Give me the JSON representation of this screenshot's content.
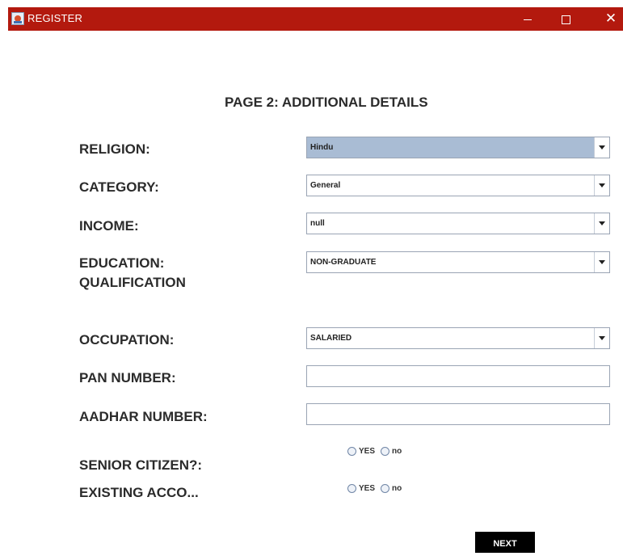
{
  "window": {
    "title": "REGISTER",
    "controls": {
      "minimize": "minimize-icon",
      "maximize": "maximize-icon",
      "close": "close-icon"
    }
  },
  "form": {
    "heading": "PAGE 2: ADDITIONAL DETAILS",
    "religion": {
      "label": "RELIGION:",
      "value": "Hindu"
    },
    "category": {
      "label": "CATEGORY:",
      "value": "General"
    },
    "income": {
      "label": "INCOME:",
      "value": "null"
    },
    "education": {
      "label_line1": "EDUCATION:",
      "label_line2": "QUALIFICATION",
      "value": "NON-GRADUATE"
    },
    "occupation": {
      "label": "OCCUPATION:",
      "value": "SALARIED"
    },
    "pan": {
      "label": "PAN NUMBER:",
      "value": ""
    },
    "aadhar": {
      "label": "AADHAR NUMBER:",
      "value": ""
    },
    "senior_citizen": {
      "label": "SENIOR CITIZEN?:",
      "yes": "YES",
      "no": "no"
    },
    "existing_account": {
      "label": "EXISTING ACCO...",
      "yes": "YES",
      "no": "no"
    },
    "next_label": "NEXT"
  },
  "colors": {
    "titlebar": "#b3190e",
    "selected_combo": "#a9bcd4",
    "button": "#000000"
  }
}
